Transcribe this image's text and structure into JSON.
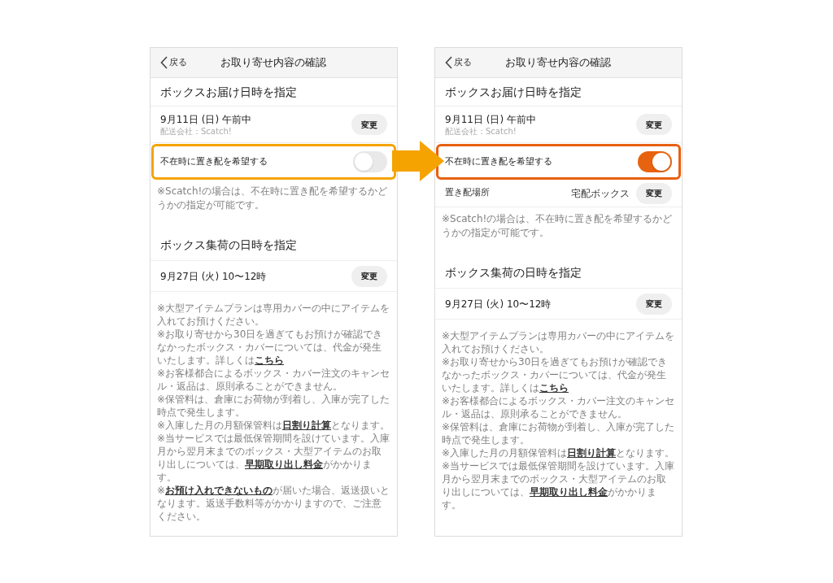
{
  "screens": [
    {
      "back": "戻る",
      "title": "お取り寄せ内容の確認",
      "delivery": {
        "heading": "ボックスお届け日時を指定",
        "date": "9月11日 (日) 午前中",
        "carrier": "配送会社：Scatch!",
        "button": "変更",
        "option": {
          "label": "不在時に置き配を希望する",
          "on": false,
          "color": "#f5a300"
        },
        "note": "※Scatch!の場合は、不在時に置き配を希望するかどうかの指定が可能です。"
      },
      "pickup": {
        "heading": "ボックス集荷の日時を指定",
        "date": "9月27日 (火) 10〜12時",
        "button": "変更"
      },
      "notes": [
        [
          {
            "text": "※大型アイテムプランは専用カバーの中にアイテムを入れてお預けください。",
            "link": false
          }
        ],
        [
          {
            "text": "※お取り寄せから30日を過ぎてもお預けが確認できなかったボックス・カバーについては、代金が発生いたします。詳しくは",
            "link": false
          },
          {
            "text": "こちら",
            "link": true
          }
        ],
        [
          {
            "text": "※お客様都合によるボックス・カバー注文のキャンセル・返品は、原則承ることができません。",
            "link": false
          }
        ],
        [
          {
            "text": "※保管料は、倉庫にお荷物が到着し、入庫が完了した時点で発生します。",
            "link": false
          }
        ],
        [
          {
            "text": "※入庫した月の月額保管料は",
            "link": false
          },
          {
            "text": "日割り計算",
            "link": true
          },
          {
            "text": "となります。",
            "link": false
          }
        ],
        [
          {
            "text": "※当サービスでは最低保管期間を設けています。入庫月から翌月末までのボックス・大型アイテムのお取り出しについては、",
            "link": false
          },
          {
            "text": "早期取り出し料金",
            "link": true
          },
          {
            "text": "がかかります。",
            "link": false
          }
        ],
        [
          {
            "text": "※",
            "link": false
          },
          {
            "text": "お預け入れできないもの",
            "link": true
          },
          {
            "text": "が届いた場合、返送扱いとなります。返送手数料等がかかりますので、ご注意ください。",
            "link": false
          }
        ]
      ]
    },
    {
      "back": "戻る",
      "title": "お取り寄せ内容の確認",
      "delivery": {
        "heading": "ボックスお届け日時を指定",
        "date": "9月11日 (日) 午前中",
        "carrier": "配送会社：Scatch!",
        "button": "変更",
        "option": {
          "label": "不在時に置き配を希望する",
          "on": true,
          "color": "#e8600f"
        },
        "place": {
          "label": "置き配場所",
          "value": "宅配ボックス",
          "button": "変更"
        },
        "note": "※Scatch!の場合は、不在時に置き配を希望するかどうかの指定が可能です。"
      },
      "pickup": {
        "heading": "ボックス集荷の日時を指定",
        "date": "9月27日 (火) 10〜12時",
        "button": "変更"
      },
      "notes": [
        [
          {
            "text": "※大型アイテムプランは専用カバーの中にアイテムを入れてお預けください。",
            "link": false
          }
        ],
        [
          {
            "text": "※お取り寄せから30日を過ぎてもお預けが確認できなかったボックス・カバーについては、代金が発生いたします。詳しくは",
            "link": false
          },
          {
            "text": "こちら",
            "link": true
          }
        ],
        [
          {
            "text": "※お客様都合によるボックス・カバー注文のキャンセル・返品は、原則承ることができません。",
            "link": false
          }
        ],
        [
          {
            "text": "※保管料は、倉庫にお荷物が到着し、入庫が完了した時点で発生します。",
            "link": false
          }
        ],
        [
          {
            "text": "※入庫した月の月額保管料は",
            "link": false
          },
          {
            "text": "日割り計算",
            "link": true
          },
          {
            "text": "となります。",
            "link": false
          }
        ],
        [
          {
            "text": "※当サービスでは最低保管期間を設けています。入庫月から翌月末までのボックス・大型アイテムのお取り出しについては、",
            "link": false
          },
          {
            "text": "早期取り出し料金",
            "link": true
          },
          {
            "text": "がかかります。",
            "link": false
          }
        ]
      ]
    }
  ]
}
